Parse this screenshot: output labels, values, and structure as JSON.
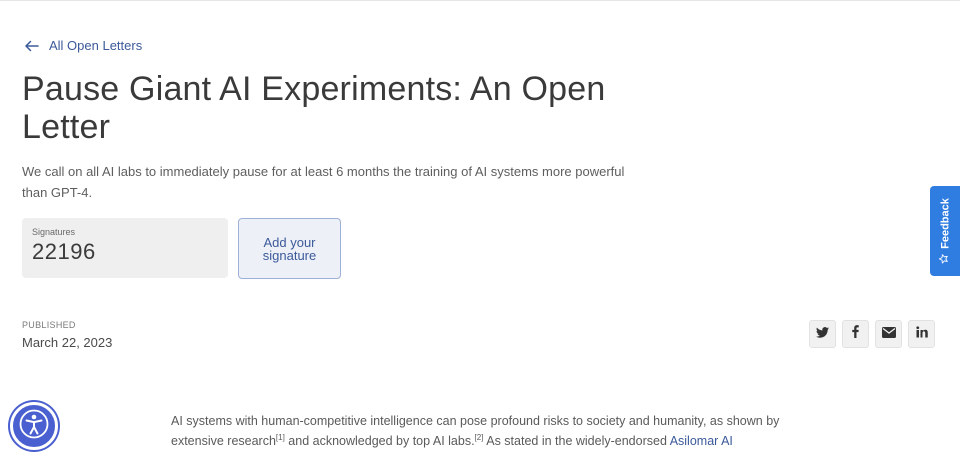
{
  "nav": {
    "back_label": "All Open Letters"
  },
  "page": {
    "title": "Pause Giant AI Experiments: An Open Letter",
    "subtitle": "We call on all AI labs to immediately pause for at least 6 months the training of AI systems more powerful than GPT-4."
  },
  "signatures": {
    "label": "Signatures",
    "count": "22196",
    "add_label": "Add your signature"
  },
  "published": {
    "label": "PUBLISHED",
    "date": "March 22, 2023"
  },
  "share": {
    "icons": [
      "twitter-icon",
      "facebook-icon",
      "email-icon",
      "linkedin-icon"
    ]
  },
  "feedback": {
    "label": "Feedback"
  },
  "body": {
    "text1": "AI systems with human-competitive intelligence can pose profound risks to society and humanity, as shown by extensive research",
    "ref1": "[1]",
    "text2": " and acknowledged by top AI labs.",
    "ref2": "[2]",
    "text3": " As stated in the widely-endorsed ",
    "link": "Asilomar AI"
  },
  "colors": {
    "accent": "#3b5a9a",
    "feedback": "#2f7de1",
    "accessibility": "#4a5fd0"
  }
}
